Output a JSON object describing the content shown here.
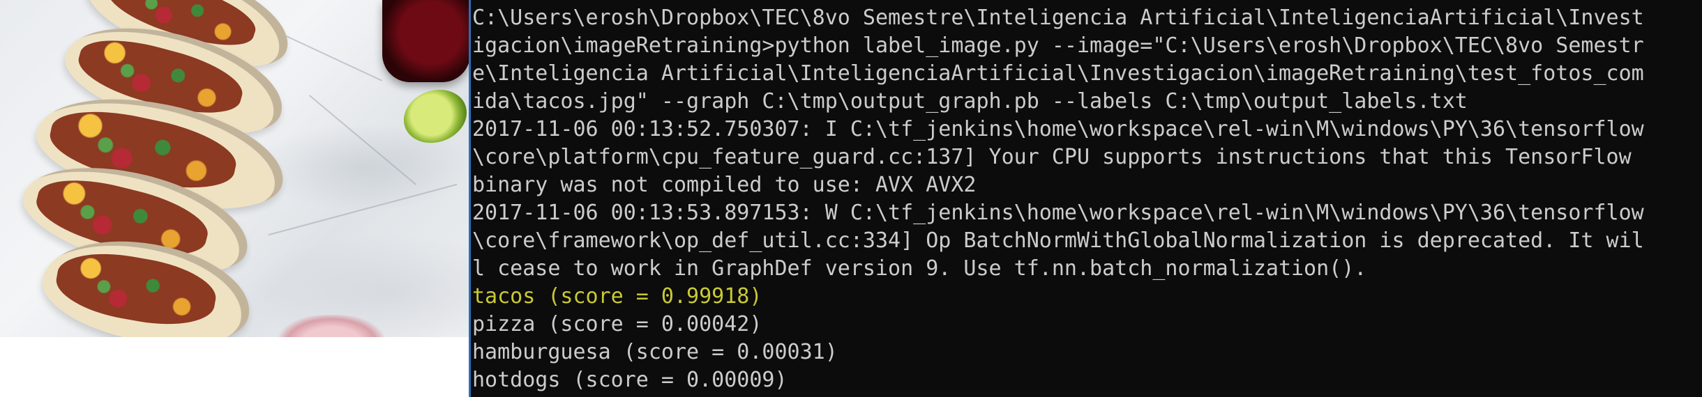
{
  "terminal": {
    "lines": [
      "C:\\Users\\erosh\\Dropbox\\TEC\\8vo Semestre\\Inteligencia Artificial\\InteligenciaArtificial\\Invest",
      "igacion\\imageRetraining>python label_image.py --image=\"C:\\Users\\erosh\\Dropbox\\TEC\\8vo Semestr",
      "e\\Inteligencia Artificial\\InteligenciaArtificial\\Investigacion\\imageRetraining\\test_fotos_com",
      "ida\\tacos.jpg\" --graph C:\\tmp\\output_graph.pb --labels C:\\tmp\\output_labels.txt",
      "2017-11-06 00:13:52.750307: I C:\\tf_jenkins\\home\\workspace\\rel-win\\M\\windows\\PY\\36\\tensorflow",
      "\\core\\platform\\cpu_feature_guard.cc:137] Your CPU supports instructions that this TensorFlow",
      "binary was not compiled to use: AVX AVX2",
      "2017-11-06 00:13:53.897153: W C:\\tf_jenkins\\home\\workspace\\rel-win\\M\\windows\\PY\\36\\tensorflow",
      "\\core\\framework\\op_def_util.cc:334] Op BatchNormWithGlobalNormalization is deprecated. It wil",
      "l cease to work in GraphDef version 9. Use tf.nn.batch_normalization().",
      "tacos (score = 0.99918)",
      "pizza (score = 0.00042)",
      "hamburguesa (score = 0.00031)",
      "hotdogs (score = 0.00009)"
    ],
    "highlight_color": "#c9c936",
    "text_color": "#cccccc",
    "background": "#0c0c0c"
  },
  "photo": {
    "subject": "tacos-photo"
  }
}
